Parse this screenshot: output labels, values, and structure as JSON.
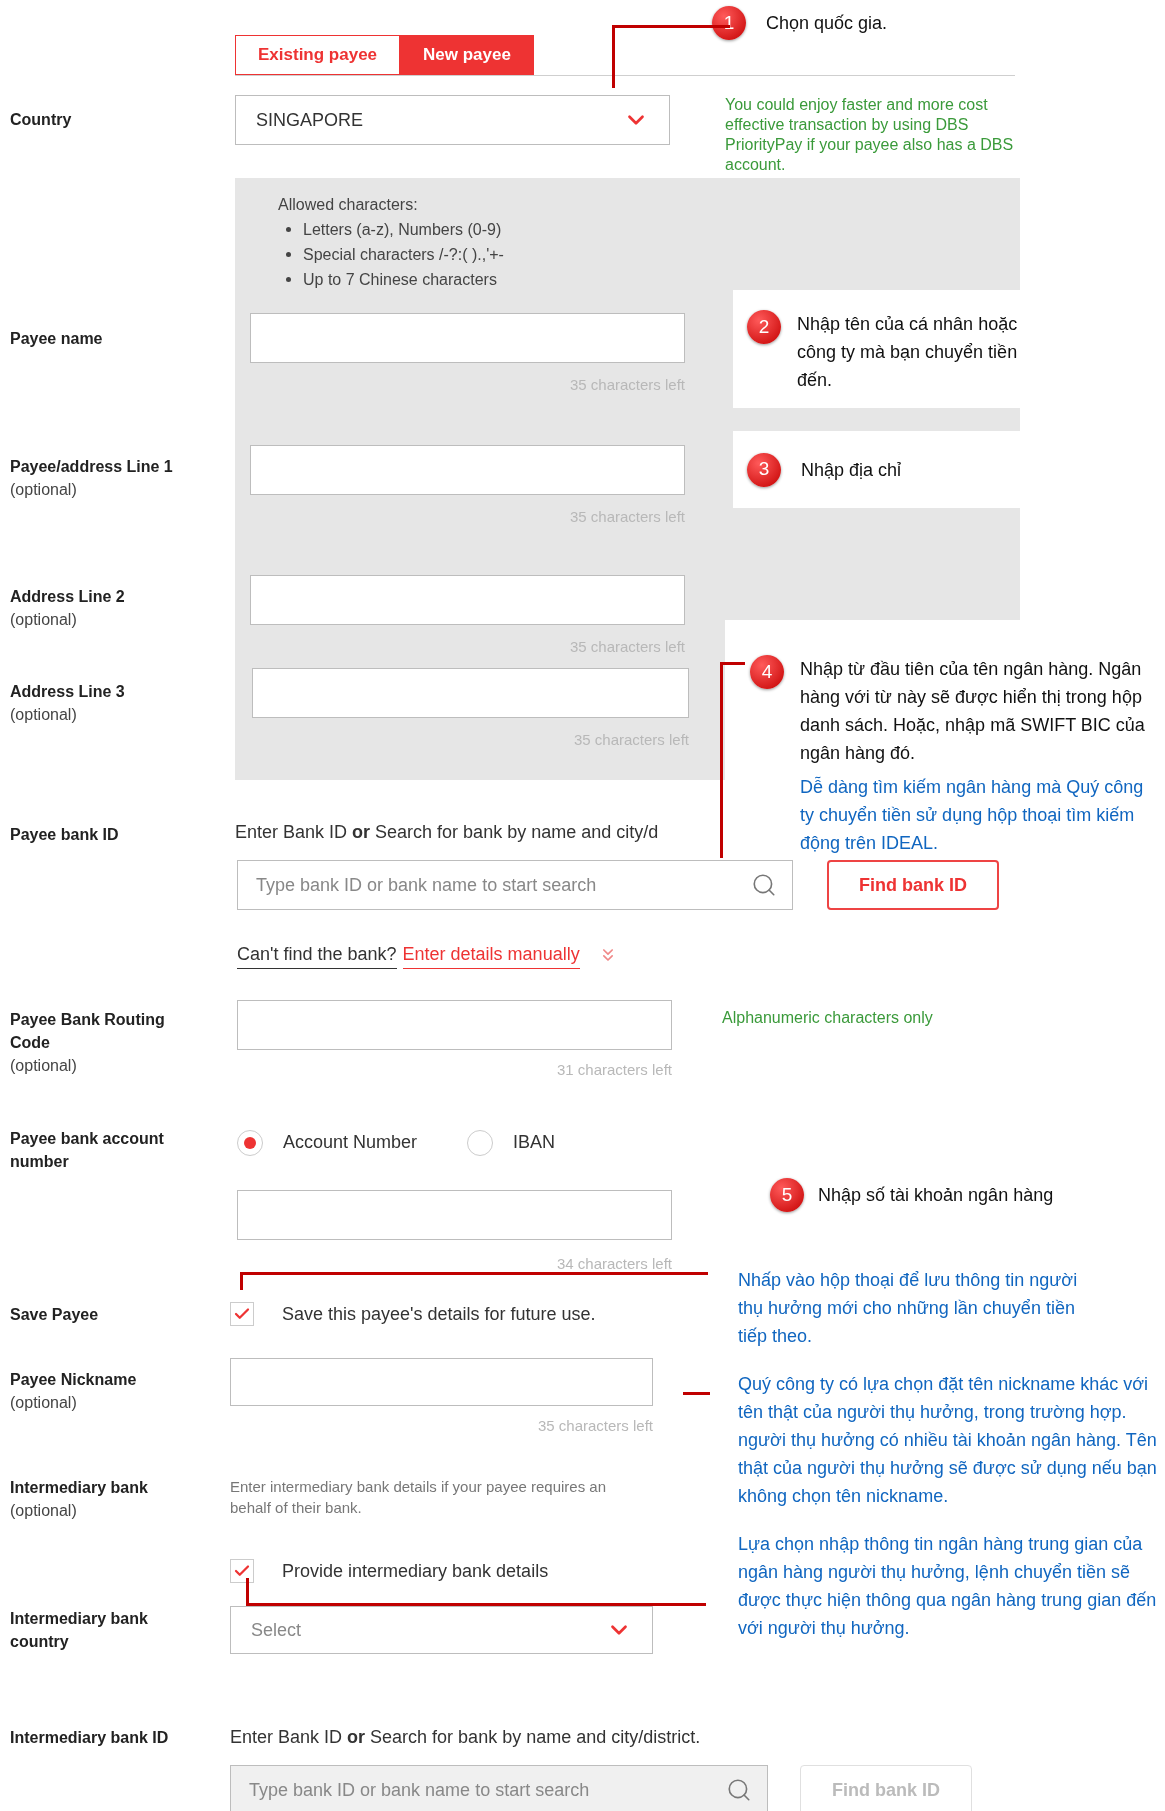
{
  "tabs": [
    {
      "label": "Existing payee",
      "selected": false
    },
    {
      "label": "New payee",
      "selected": true
    }
  ],
  "country": {
    "label": "Country",
    "value": "SINGAPORE",
    "note": "You could enjoy faster and more cost effective transaction by using DBS PriorityPay if your payee also has a DBS account."
  },
  "allowed_characters": {
    "title": "Allowed characters:",
    "items": [
      "Letters (a-z), Numbers (0-9)",
      "Special characters /-?:( ).,'+-",
      "Up to 7 Chinese characters"
    ]
  },
  "text_fields": [
    {
      "label": "Payee name",
      "counter": "35 characters left"
    },
    {
      "label": "Payee/address Line 1",
      "hint": "(optional)",
      "counter": "35 characters left"
    },
    {
      "label": "Address Line 2",
      "hint": "(optional)",
      "counter": "35 characters left"
    },
    {
      "label": "Address Line 3",
      "hint": "(optional)",
      "counter": "35 characters left"
    }
  ],
  "payee_bank_id": {
    "label": "Payee bank ID",
    "instruction": "Enter Bank ID **or** Search for bank by name and city/d",
    "placeholder": "Type bank ID or bank name to start search",
    "find_button": {
      "label": "Find bank ID",
      "disabled": false
    },
    "question": "Can't find the bank?",
    "link": "Enter details manually"
  },
  "routing_code": {
    "label": "Payee Bank Routing Code",
    "hint": "(optional)",
    "counter": "31 characters left",
    "note": "Alphanumeric characters only"
  },
  "account_number": {
    "label": "Payee bank account number",
    "options": [
      {
        "label": "Account Number",
        "selected": true
      },
      {
        "label": "IBAN",
        "selected": false
      }
    ],
    "counter": "34 characters left"
  },
  "save_payee": {
    "label": "Save Payee",
    "option": "Save this payee's details for future use.",
    "checked": true
  },
  "nickname": {
    "label": "Payee Nickname",
    "hint": "(optional)",
    "counter": "35 characters left"
  },
  "intermediary_bank": {
    "label": "Intermediary bank",
    "hint": "(optional)",
    "lines": [
      "Enter intermediary bank details if your payee requires an",
      "behalf of their bank."
    ],
    "option": "Provide intermediary bank details",
    "checked": true
  },
  "intermediary_country": {
    "label": "Intermediary bank country",
    "placeholder": "Select"
  },
  "intermediary_bank_id": {
    "label": "Intermediary bank ID",
    "instruction": "Enter Bank ID **or** Search for bank by name and city/district.",
    "placeholder": "Type bank ID or bank name to start search",
    "find_button": {
      "label": "Find bank ID",
      "disabled": true
    }
  },
  "callouts": [
    {
      "number": "1",
      "text": "Chọn quốc gia."
    },
    {
      "number": "2",
      "text": "Nhập tên của cá nhân hoặc công ty mà bạn chuyển tiền đến."
    },
    {
      "number": "3",
      "text": "Nhập địa chỉ"
    },
    {
      "number": "4",
      "text": "Nhập từ đầu tiên của tên ngân hàng. Ngân hàng với từ này sẽ được hiển thị trong hộp danh sách. Hoặc, nhập mã SWIFT BIC của ngân hàng đó.",
      "note": "Dễ dàng tìm kiếm ngân hàng mà Quý công ty chuyển tiền sử dụng hộp thoại tìm kiếm động trên IDEAL."
    },
    {
      "number": "5",
      "text": "Nhập số tài khoản ngân hàng"
    }
  ],
  "notes": [
    "Nhấp vào hộp thoại để lưu thông tin người thụ hưởng mới cho những lần chuyển tiền tiếp theo.",
    "Quý công ty có lựa chọn đặt tên nickname khác với tên thật của người thụ hưởng, trong trường hợp. người thụ hưởng có nhiều tài khoản ngân hàng. Tên thật của người thụ hưởng sẽ được sử dụng nếu bạn không chọn tên nickname.",
    "Lựa chọn nhập thông tin ngân hàng trung gian của ngân hàng người thụ hưởng, lệnh chuyển tiền sẽ được thực hiện thông qua ngân hàng trung gian đến với người thụ hưởng."
  ]
}
